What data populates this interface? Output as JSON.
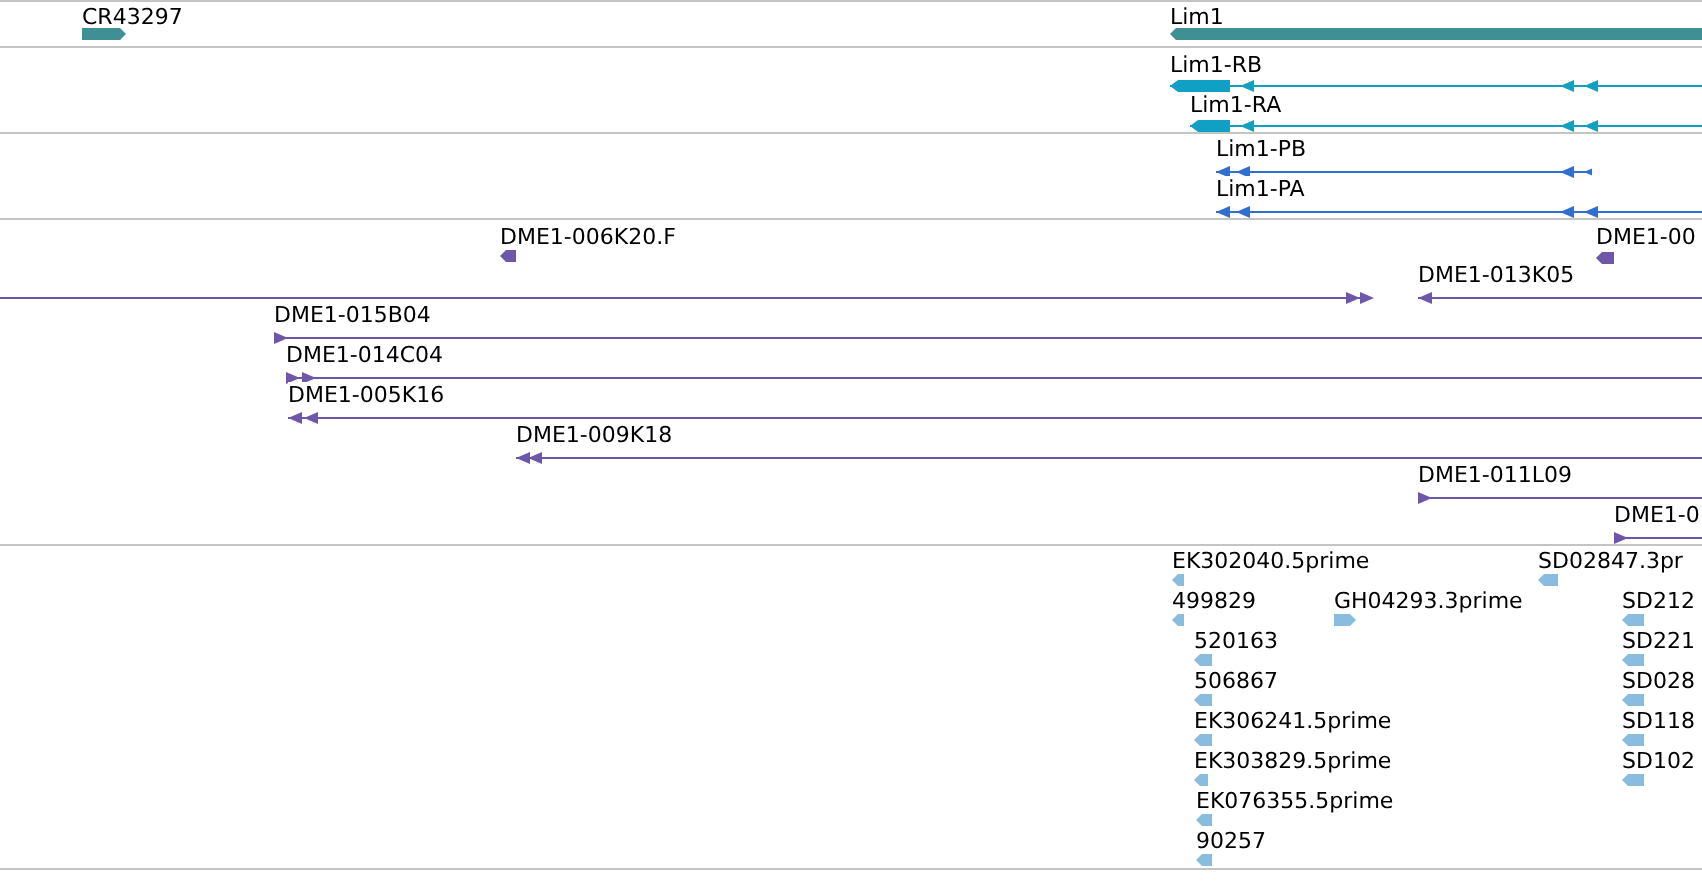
{
  "tracks": [
    {
      "color": "#3f8f94",
      "features": [
        {
          "label": "CR43297"
        },
        {
          "label": "Lim1"
        }
      ]
    },
    {
      "color": "#10a0c4",
      "features": [
        {
          "label": "Lim1-RB"
        },
        {
          "label": "Lim1-RA"
        }
      ]
    },
    {
      "color": "#2f6fd0",
      "features": [
        {
          "label": "Lim1-PB"
        },
        {
          "label": "Lim1-PA"
        }
      ]
    },
    {
      "color": "#6e56a8",
      "features": [
        {
          "label": "DME1-006K20.F"
        },
        {
          "label": "DME1-00"
        },
        {
          "label": "DME1-013K05"
        },
        {
          "label": "DME1-015B04"
        },
        {
          "label": "DME1-014C04"
        },
        {
          "label": "DME1-005K16"
        },
        {
          "label": "DME1-009K18"
        },
        {
          "label": "DME1-011L09"
        },
        {
          "label": "DME1-0"
        }
      ]
    },
    {
      "color": "#88bde0",
      "features": [
        {
          "label": "EK302040.5prime"
        },
        {
          "label": "499829"
        },
        {
          "label": "GH04293.3prime"
        },
        {
          "label": "520163"
        },
        {
          "label": "506867"
        },
        {
          "label": "EK306241.5prime"
        },
        {
          "label": "EK303829.5prime"
        },
        {
          "label": "EK076355.5prime"
        },
        {
          "label": "90257"
        },
        {
          "label": "SD02847.3pr"
        },
        {
          "label": "SD212"
        },
        {
          "label": "SD221"
        },
        {
          "label": "SD028"
        },
        {
          "label": "SD118"
        },
        {
          "label": "SD102"
        }
      ]
    }
  ]
}
